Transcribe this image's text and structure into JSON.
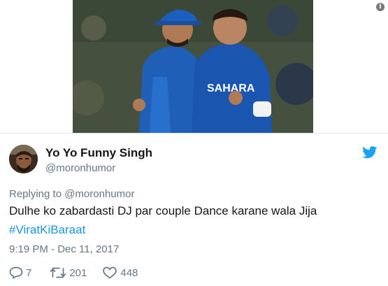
{
  "embed": {
    "photo_icon": "cricket-players-photo",
    "info_icon": "info-icon",
    "info_glyph": "i"
  },
  "tweet": {
    "display_name": "Yo Yo Funny Singh",
    "handle": "@moronhumor",
    "reply_to": "Replying to @moronhumor",
    "text": "Dulhe ko zabardasti DJ par couple Dance karane wala Jija",
    "hashtag": "#ViratKiBaraat",
    "timestamp": "9:19 PM - Dec 11, 2017",
    "actions": {
      "reply_count": "7",
      "retweet_count": "201",
      "like_count": "448"
    }
  },
  "colors": {
    "text": "#14171a",
    "muted": "#657786",
    "link": "#1b95e0",
    "twitter_blue": "#1da1f2",
    "divider": "#e1e8ed"
  }
}
